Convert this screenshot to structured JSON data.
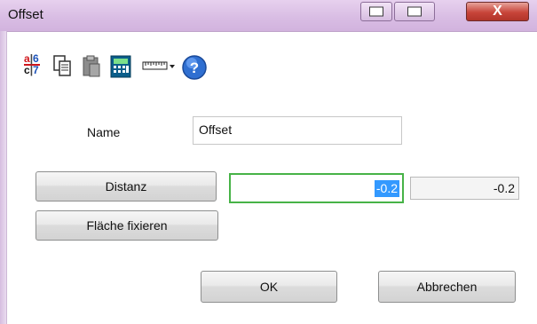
{
  "window": {
    "title": "Offset",
    "close_label": "X"
  },
  "toolbar": {
    "icons": [
      "fraction-icon",
      "copy-icon",
      "paste-icon",
      "calculator-icon",
      "ruler-icon",
      "help-icon"
    ]
  },
  "fraction_icon": {
    "a": "a",
    "b": "6",
    "c": "c",
    "d": "7"
  },
  "form": {
    "name_label": "Name",
    "name_value": "Offset",
    "distanz_button": "Distanz",
    "distanz_value": "-0.2",
    "distanz_readout": "-0.2",
    "flaeche_button": "Fläche fixieren",
    "ok_button": "OK",
    "cancel_button": "Abbrechen"
  },
  "colors": {
    "titlebar": "#dcc2e6",
    "close_button": "#c8453a",
    "focus_border": "#47b347",
    "selection": "#3399ff"
  }
}
